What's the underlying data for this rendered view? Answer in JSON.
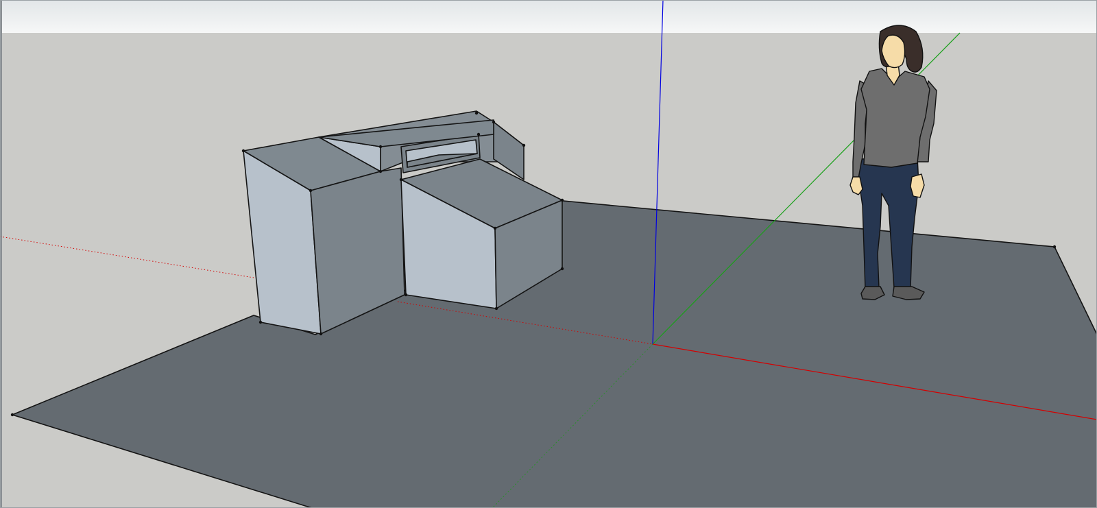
{
  "viewport": {
    "sky_color_top": "#e5e8e9",
    "sky_color_bottom": "#f4f5f5",
    "ground_color": "#cbcbc8",
    "plane_color": "#646b71",
    "edge_color": "#1a1a1a",
    "face_light": "#b7c1cb",
    "face_medium": "#7b848b",
    "face_top": "#808990",
    "axis_red": "#d40000",
    "axis_green": "#19a019",
    "axis_blue": "#0000e0"
  },
  "scale_figure": {
    "skin": "#f6dca8",
    "hair": "#3a2e2a",
    "shirt": "#6e6e6e",
    "jeans": "#263650",
    "shoes": "#555555"
  },
  "model": {
    "name": "3d-model-block"
  }
}
